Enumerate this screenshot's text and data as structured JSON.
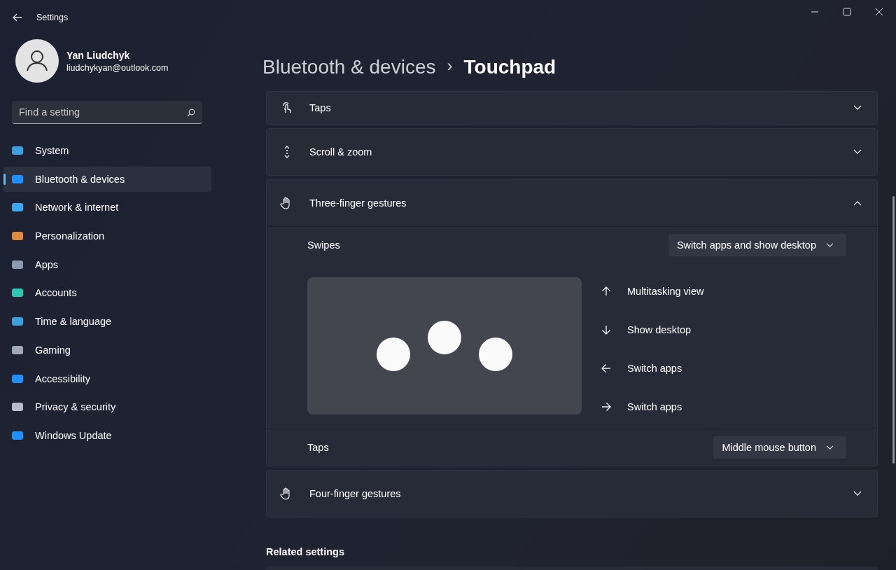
{
  "window": {
    "title": "Settings"
  },
  "profile": {
    "name": "Yan Liudchyk",
    "email": "liudchykyan@outlook.com"
  },
  "search": {
    "placeholder": "Find a setting"
  },
  "sidebar": {
    "items": [
      {
        "label": "System",
        "selected": false
      },
      {
        "label": "Bluetooth & devices",
        "selected": true
      },
      {
        "label": "Network & internet",
        "selected": false
      },
      {
        "label": "Personalization",
        "selected": false
      },
      {
        "label": "Apps",
        "selected": false
      },
      {
        "label": "Accounts",
        "selected": false
      },
      {
        "label": "Time & language",
        "selected": false
      },
      {
        "label": "Gaming",
        "selected": false
      },
      {
        "label": "Accessibility",
        "selected": false
      },
      {
        "label": "Privacy & security",
        "selected": false
      },
      {
        "label": "Windows Update",
        "selected": false
      }
    ]
  },
  "breadcrumb": {
    "parent": "Bluetooth & devices",
    "separator": "›",
    "current": "Touchpad"
  },
  "sections": [
    {
      "title": "Taps",
      "expanded": false
    },
    {
      "title": "Scroll & zoom",
      "expanded": false
    },
    {
      "title": "Three-finger gestures",
      "expanded": true,
      "swipes": {
        "label": "Swipes",
        "value": "Switch apps and show desktop"
      },
      "gestures": [
        "Multitasking view",
        "Show desktop",
        "Switch apps",
        "Switch apps"
      ],
      "taps": {
        "label": "Taps",
        "value": "Middle mouse button"
      }
    },
    {
      "title": "Four-finger gestures",
      "expanded": false
    }
  ],
  "related": {
    "title": "Related settings"
  }
}
